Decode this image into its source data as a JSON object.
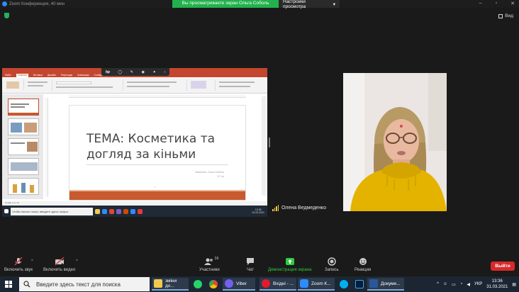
{
  "window": {
    "title": "Zoom Конференция, 40 мин",
    "controls": [
      "–",
      "▫",
      "✕"
    ]
  },
  "share_banner": {
    "text": "Вы просматриваете экран Ольга Соболь",
    "settings": "Настройки просмотра",
    "chevron": "▾",
    "settings_color": "#23b14d"
  },
  "view_button": {
    "label": "Вид"
  },
  "shared_screen": {
    "ppt_tabs": [
      "Файл",
      "Главная",
      "Вставка",
      "Дизайн",
      "Переходы",
      "Анимация",
      "Слайд-шоу"
    ],
    "slide_title": "ТЕМА: Косметика та догляд за кіньми",
    "slide_author_line1": "Виконала: Ольга Соболь",
    "slide_author_line2": "3-Г кл",
    "slide_number": "1",
    "thumb_numbers": [
      "1",
      "2",
      "3",
      "4",
      "5"
    ],
    "status_text": "Слайд 1 из 10",
    "taskbar_search": "Чтобы начать поиск, введите здесь запрос",
    "clock_time": "13:36",
    "clock_date": "31.03.2021",
    "accent_color": "#c5462e"
  },
  "participant": {
    "name": "Олена Ведмеденко"
  },
  "toolbar": {
    "mute_label": "Включить звук",
    "video_label": "Включить видео",
    "participants_label": "Участники",
    "participants_count": "16",
    "chat_label": "Чат",
    "share_label": "Демонстрация экрана",
    "record_label": "Запись",
    "reactions_label": "Реакции",
    "exit_label": "Выйти",
    "share_color": "#2ecc40",
    "exit_color": "#d82a2a"
  },
  "taskbar": {
    "search_placeholder": "Введите здесь текст для поиска",
    "items": [
      {
        "label": "зміни до...",
        "icon": "file-explorer-icon"
      },
      {
        "label": "",
        "icon": "whatsapp-icon"
      },
      {
        "label": "",
        "icon": "chrome-icon"
      },
      {
        "label": "Viber",
        "icon": "viber-icon"
      },
      {
        "label": "Вхідні - ...",
        "icon": "opera-icon"
      },
      {
        "label": "Zoom К...",
        "icon": "zoom-icon"
      },
      {
        "label": "",
        "icon": "skype-icon"
      },
      {
        "label": "",
        "icon": "photoshop-icon"
      },
      {
        "label": "Докуме...",
        "icon": "word-icon"
      }
    ],
    "language": "УКР",
    "time": "13:36",
    "date": "31.03.2021"
  }
}
